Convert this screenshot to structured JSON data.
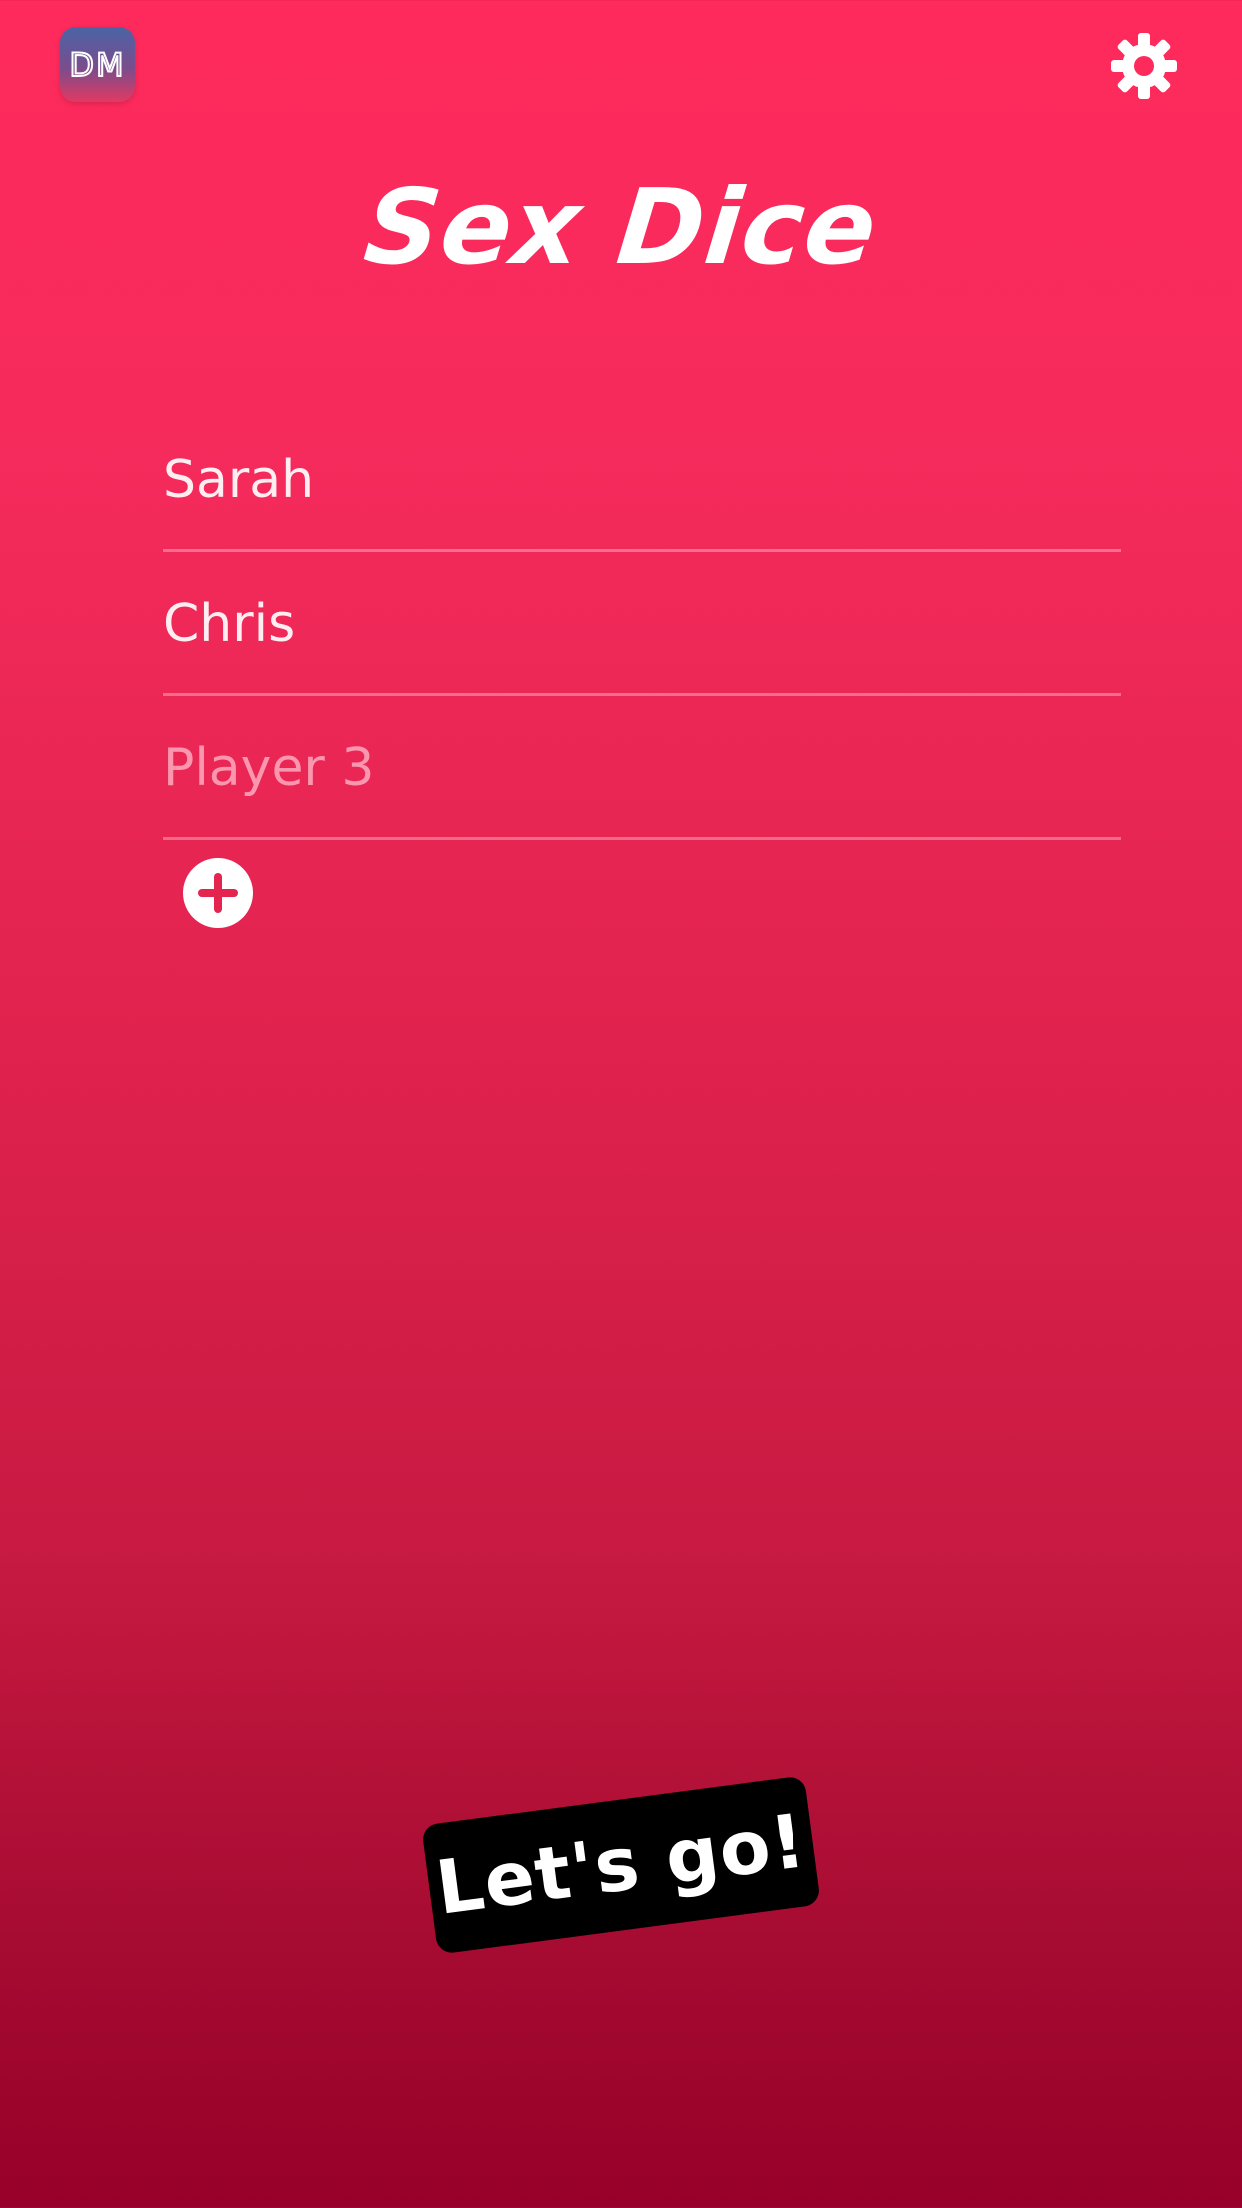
{
  "header": {
    "app_icon_text": "DM",
    "settings_icon": "gear-icon"
  },
  "title": "Sex Dice",
  "players": [
    {
      "value": "Sarah",
      "placeholder": ""
    },
    {
      "value": "Chris",
      "placeholder": ""
    },
    {
      "value": "",
      "placeholder": "Player 3"
    }
  ],
  "add_player_icon": "plus-circle-icon",
  "start_button": {
    "label": "Let's go!"
  },
  "colors": {
    "background_top": "#ff2a5c",
    "background_bottom": "#97002a",
    "button": "#000000",
    "text": "#ffffff"
  }
}
